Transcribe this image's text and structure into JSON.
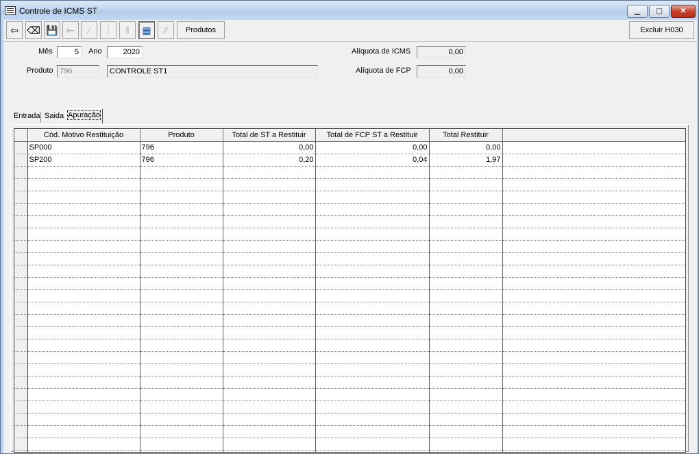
{
  "window": {
    "title": "Controle de ICMS ST",
    "min_symbol": "▁",
    "max_symbol": "▢",
    "close_symbol": "✕"
  },
  "toolbar": {
    "buttons": [
      {
        "icon": "exit-icon",
        "glyph": "⇦",
        "enabled": true
      },
      {
        "icon": "eraser-icon",
        "glyph": "⌫",
        "enabled": true
      },
      {
        "icon": "save-icon",
        "glyph": "💾",
        "enabled": true
      },
      {
        "icon": "first-icon",
        "glyph": "⇤",
        "enabled": false
      },
      {
        "icon": "prev-icon",
        "glyph": "∕",
        "enabled": false
      },
      {
        "icon": "next-icon",
        "glyph": "⏐",
        "enabled": false
      },
      {
        "icon": "pause-icon",
        "glyph": "‖",
        "enabled": false
      },
      {
        "icon": "grid-icon",
        "glyph": "▦",
        "enabled": true
      },
      {
        "icon": "edit-disabled-icon",
        "glyph": "⁄⁄",
        "enabled": false
      }
    ],
    "produtos_label": "Produtos",
    "excluir_label": "Excluir H030"
  },
  "form": {
    "mes_label": "Mês",
    "mes_value": "5",
    "ano_label": "Ano",
    "ano_value": "2020",
    "produto_label": "Produto",
    "produto_code": "796",
    "produto_desc": "CONTROLE ST1",
    "aliquota_icms_label": "Alíquota de ICMS",
    "aliquota_icms_value": "0,00",
    "aliquota_fcp_label": "Alíquota de FCP",
    "aliquota_fcp_value": "0,00"
  },
  "tabs": [
    "Entrada",
    "Saida",
    "Apuração"
  ],
  "active_tab": "Apuração",
  "grid": {
    "columns": [
      "Cód. Motivo Restituição",
      "Produto",
      "Total de ST a Restituir",
      "Total de FCP ST a Restituir",
      "Total Restituir"
    ],
    "rows": [
      [
        "SP000",
        "796",
        "0,00",
        "0,00",
        "0,00"
      ],
      [
        "SP200",
        "796",
        "0,20",
        "0,04",
        "1,97"
      ]
    ],
    "empty_rows": 24
  }
}
